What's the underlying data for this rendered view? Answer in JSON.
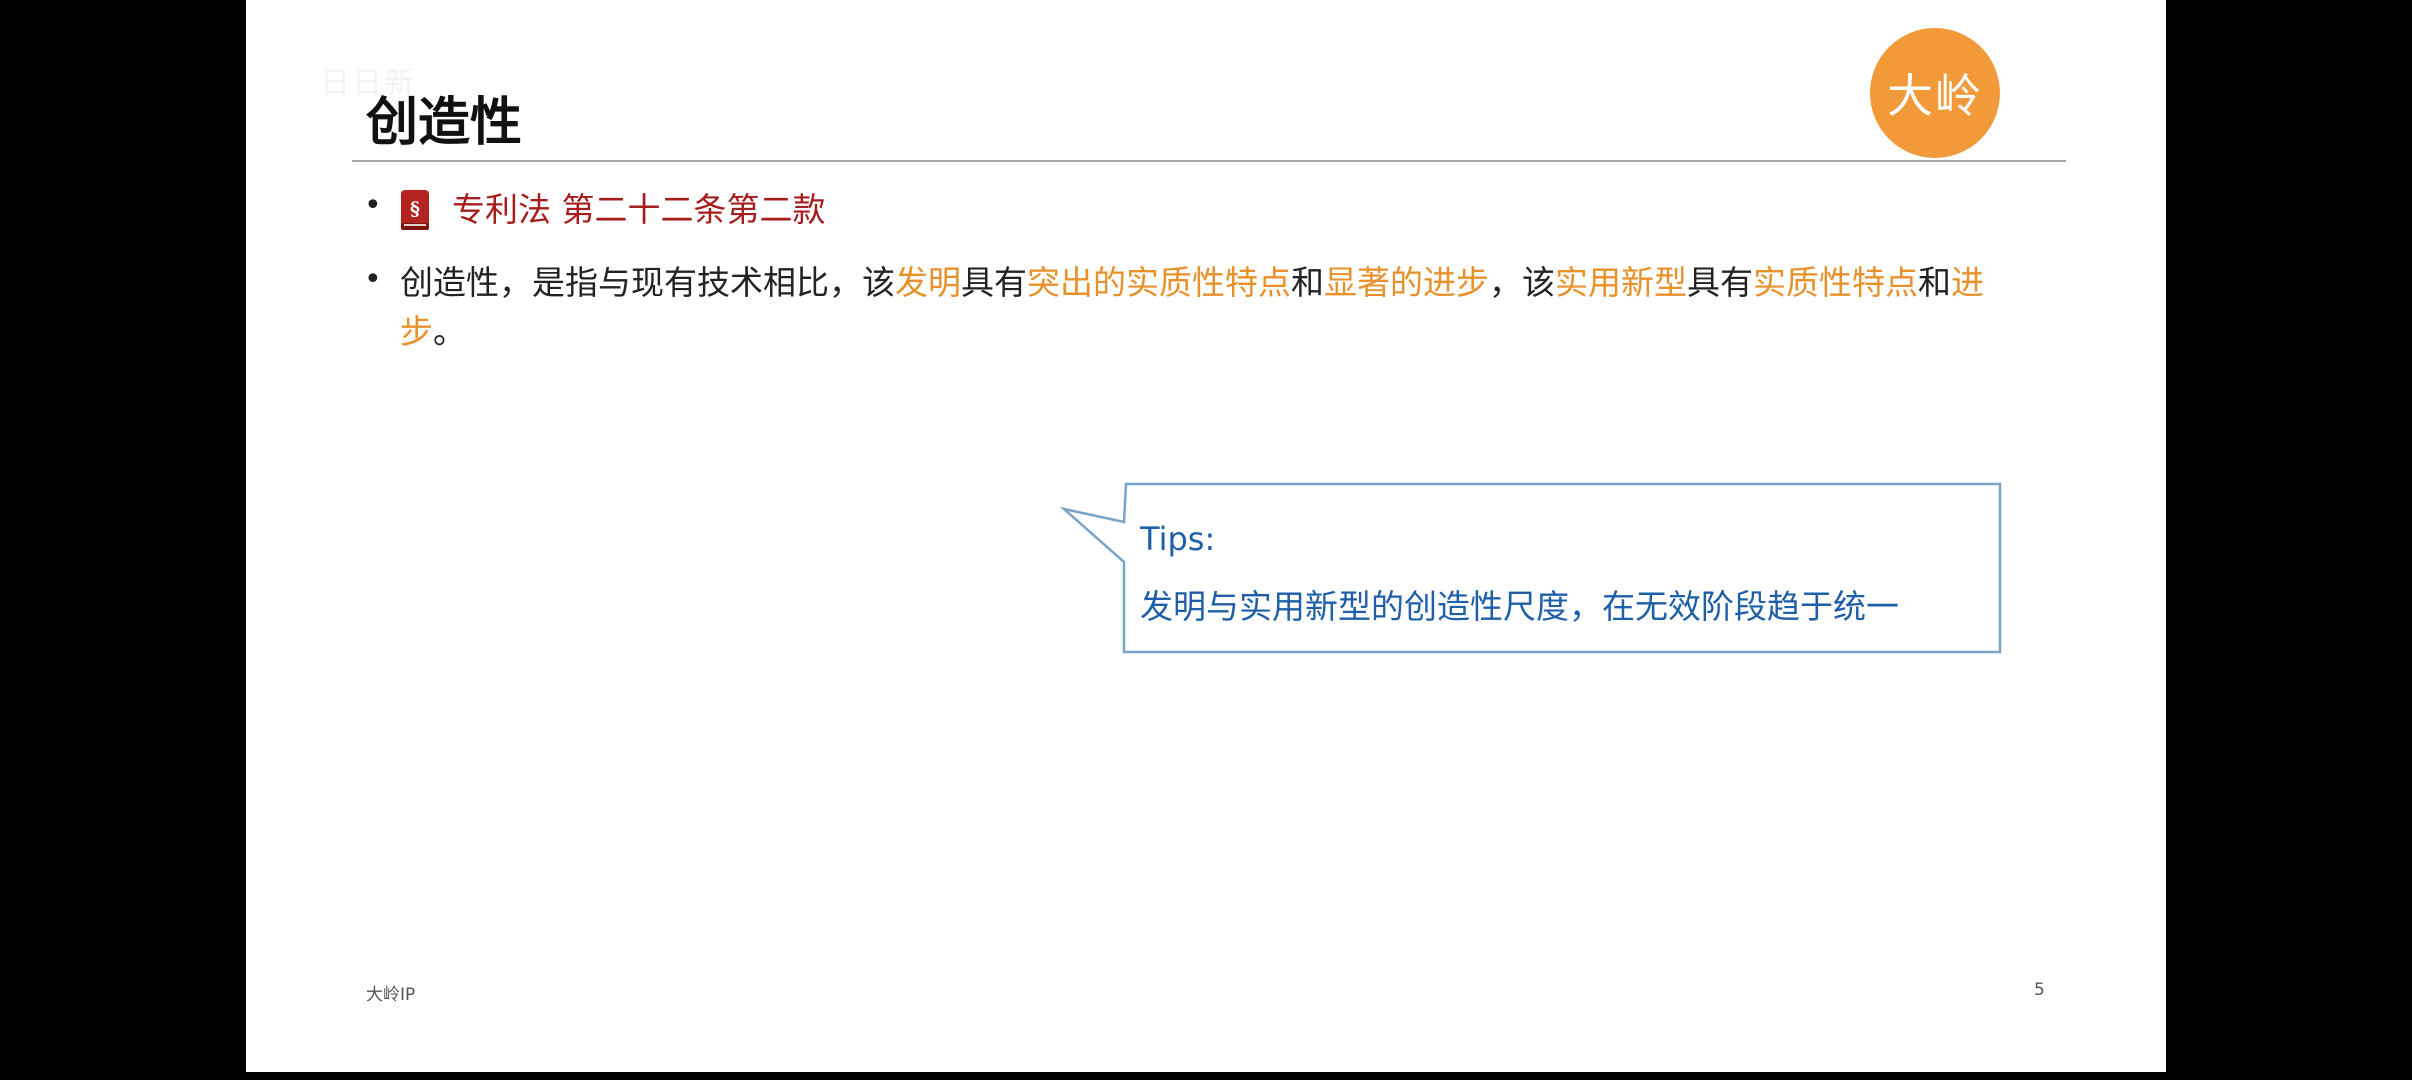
{
  "slide": {
    "watermark": "日日新",
    "title": "创造性",
    "logo_text": "大岭",
    "law_reference": "专利法 第二十二条第二款",
    "definition": [
      {
        "text": "创造性，是指与现有技术相比，该",
        "highlight": false
      },
      {
        "text": "发明",
        "highlight": true
      },
      {
        "text": "具有",
        "highlight": false
      },
      {
        "text": "突出的实质性特点",
        "highlight": true
      },
      {
        "text": "和",
        "highlight": false
      },
      {
        "text": "显著的进步",
        "highlight": true
      },
      {
        "text": "，该",
        "highlight": false
      },
      {
        "text": "实用新型",
        "highlight": true
      },
      {
        "text": "具有",
        "highlight": false
      },
      {
        "text": "实质性特点",
        "highlight": true
      },
      {
        "text": "和",
        "highlight": false
      },
      {
        "text": "进步",
        "highlight": true
      },
      {
        "text": "。",
        "highlight": false
      }
    ],
    "tips": {
      "title": "Tips:",
      "text": "发明与实用新型的创造性尺度，在无效阶段趋于统一"
    },
    "footer": {
      "left": "大岭IP",
      "page_number": "5"
    }
  },
  "colors": {
    "law_red": "#a61d1d",
    "highlight_orange": "#e8912a",
    "tips_blue": "#1f5fa8",
    "logo_orange": "#f29a3a"
  },
  "icons": {
    "law_book": "law-book-icon"
  }
}
